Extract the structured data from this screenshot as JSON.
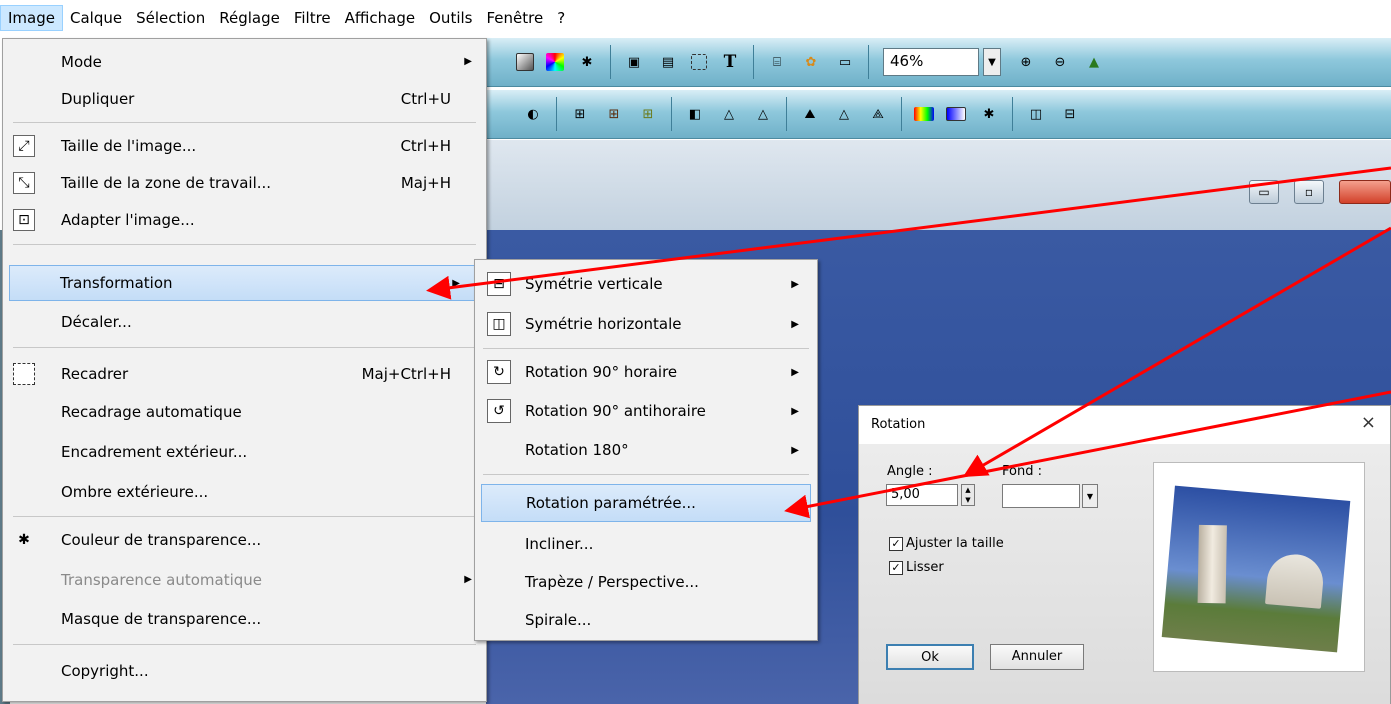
{
  "menubar": [
    "Image",
    "Calque",
    "Sélection",
    "Réglage",
    "Filtre",
    "Affichage",
    "Outils",
    "Fenêtre",
    "?"
  ],
  "toolbar": {
    "zoom_value": "46%"
  },
  "image_menu": [
    {
      "label": "Mode",
      "shortcut": "",
      "arrow": true
    },
    {
      "label": "Dupliquer",
      "shortcut": "Ctrl+U",
      "arrow": false
    },
    {
      "label": "Taille de l'image...",
      "shortcut": "Ctrl+H",
      "arrow": false
    },
    {
      "label": "Taille de la zone de travail...",
      "shortcut": "Maj+H",
      "arrow": false
    },
    {
      "label": "Adapter l'image...",
      "shortcut": "",
      "arrow": false
    },
    {
      "label": "Transformation",
      "shortcut": "",
      "arrow": true
    },
    {
      "label": "Décaler...",
      "shortcut": "",
      "arrow": false
    },
    {
      "label": "Recadrer",
      "shortcut": "Maj+Ctrl+H",
      "arrow": false
    },
    {
      "label": "Recadrage automatique",
      "shortcut": "",
      "arrow": false
    },
    {
      "label": "Encadrement extérieur...",
      "shortcut": "",
      "arrow": false
    },
    {
      "label": "Ombre extérieure...",
      "shortcut": "",
      "arrow": false
    },
    {
      "label": "Couleur de transparence...",
      "shortcut": "",
      "arrow": false
    },
    {
      "label": "Transparence automatique",
      "shortcut": "",
      "arrow": true,
      "disabled": true
    },
    {
      "label": "Masque de transparence...",
      "shortcut": "",
      "arrow": false
    },
    {
      "label": "Copyright...",
      "shortcut": "",
      "arrow": false
    }
  ],
  "transform_menu": [
    {
      "label": "Symétrie verticale",
      "arrow": true
    },
    {
      "label": "Symétrie horizontale",
      "arrow": true
    },
    {
      "label": "Rotation 90° horaire",
      "arrow": true
    },
    {
      "label": "Rotation 90° antihoraire",
      "arrow": true
    },
    {
      "label": "Rotation 180°",
      "arrow": true
    },
    {
      "label": "Rotation paramétrée...",
      "arrow": false
    },
    {
      "label": "Incliner...",
      "arrow": false
    },
    {
      "label": "Trapèze / Perspective...",
      "arrow": false
    },
    {
      "label": "Spirale...",
      "arrow": false
    }
  ],
  "dialog": {
    "title": "Rotation",
    "close": "×",
    "angle_label": "Angle :",
    "angle_value": "5,00",
    "fond_label": "Fond :",
    "ajuster_label": "Ajuster la taille",
    "ajuster_checked": true,
    "lisser_label": "Lisser",
    "lisser_checked": true,
    "ok_label": "Ok",
    "cancel_label": "Annuler"
  },
  "colors": {
    "highlight": "#cce8ff",
    "arrow": "#ff0000",
    "toolbar": "#8ec8dc",
    "sky": "#2f4f9a"
  }
}
